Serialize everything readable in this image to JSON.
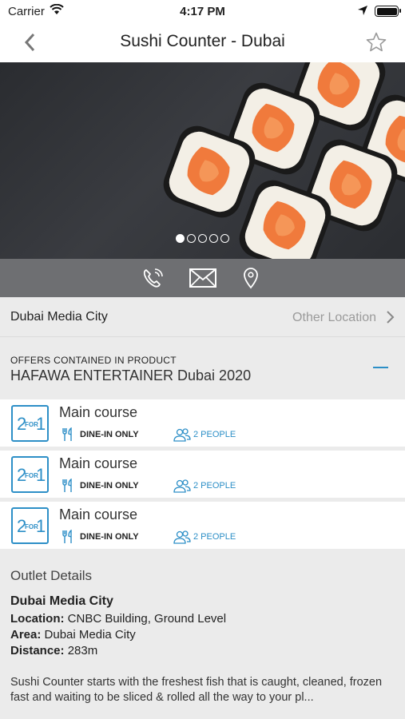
{
  "status_bar": {
    "carrier": "Carrier",
    "time": "4:17 PM"
  },
  "nav": {
    "title": "Sushi Counter - Dubai"
  },
  "gallery": {
    "page_count": 5,
    "active_page": 1
  },
  "location": {
    "name": "Dubai Media City",
    "other_label": "Other Location"
  },
  "offers_section": {
    "label": "OFFERS CONTAINED IN PRODUCT",
    "product": "HAFAWA ENTERTAINER Dubai 2020"
  },
  "offers": [
    {
      "badge": {
        "left": "2",
        "middle": "FOR",
        "right": "1"
      },
      "title": "Main course",
      "restriction": "DINE-IN ONLY",
      "people": "2 PEOPLE"
    },
    {
      "badge": {
        "left": "2",
        "middle": "FOR",
        "right": "1"
      },
      "title": "Main course",
      "restriction": "DINE-IN ONLY",
      "people": "2 PEOPLE"
    },
    {
      "badge": {
        "left": "2",
        "middle": "FOR",
        "right": "1"
      },
      "title": "Main course",
      "restriction": "DINE-IN ONLY",
      "people": "2 PEOPLE"
    }
  ],
  "outlet": {
    "heading": "Outlet Details",
    "name": "Dubai Media City",
    "location_label": "Location:",
    "location_value": " CNBC Building, Ground Level",
    "area_label": "Area:",
    "area_value": " Dubai Media City",
    "distance_label": "Distance:",
    "distance_value": " 283m",
    "description": "Sushi Counter starts with the freshest fish that is caught, cleaned, frozen fast and waiting to be sliced & rolled all the way to your pl..."
  },
  "colors": {
    "accent": "#2d8fc7",
    "action_bar": "#6e6f72",
    "salmon": "#f07a3c"
  },
  "icons": [
    "back-chevron-icon",
    "star-icon",
    "phone-icon",
    "mail-icon",
    "map-pin-icon",
    "chevron-right-icon",
    "cutlery-icon",
    "people-icon"
  ]
}
